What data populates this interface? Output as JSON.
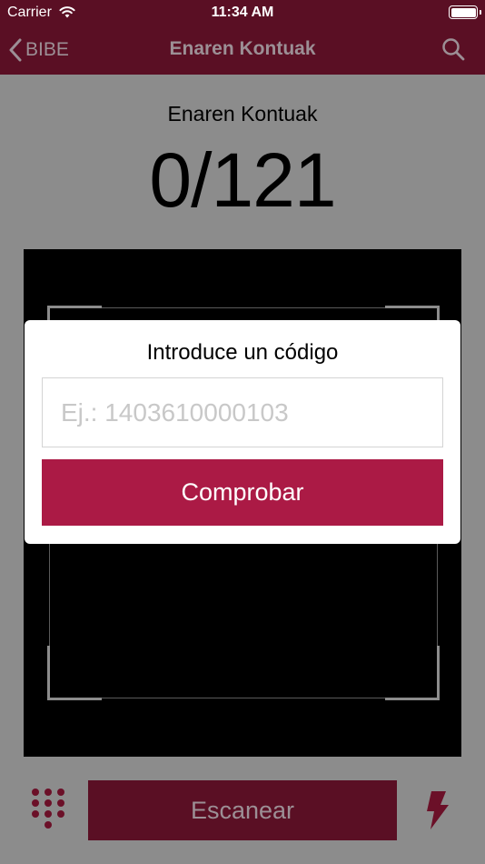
{
  "status_bar": {
    "carrier": "Carrier",
    "time": "11:34 AM"
  },
  "nav": {
    "back_label": "BIBE",
    "title": "Enaren Kontuak"
  },
  "counter": {
    "label": "Enaren Kontuak",
    "value": "0/121"
  },
  "dialog": {
    "title": "Introduce un código",
    "input_value": "",
    "input_placeholder": "Ej.: 1403610000103",
    "button_label": "Comprobar"
  },
  "bottom": {
    "scan_label": "Escanear"
  },
  "icons": {
    "back": "chevron-left-icon",
    "search": "search-icon",
    "keypad": "keypad-icon",
    "flash": "flash-icon",
    "wifi": "wifi-icon",
    "battery": "battery-icon"
  },
  "colors": {
    "nav_bg": "#5a0f24",
    "accent": "#ab1a45",
    "nav_text": "#9c8f95",
    "overlay": "#8c8c8c"
  }
}
